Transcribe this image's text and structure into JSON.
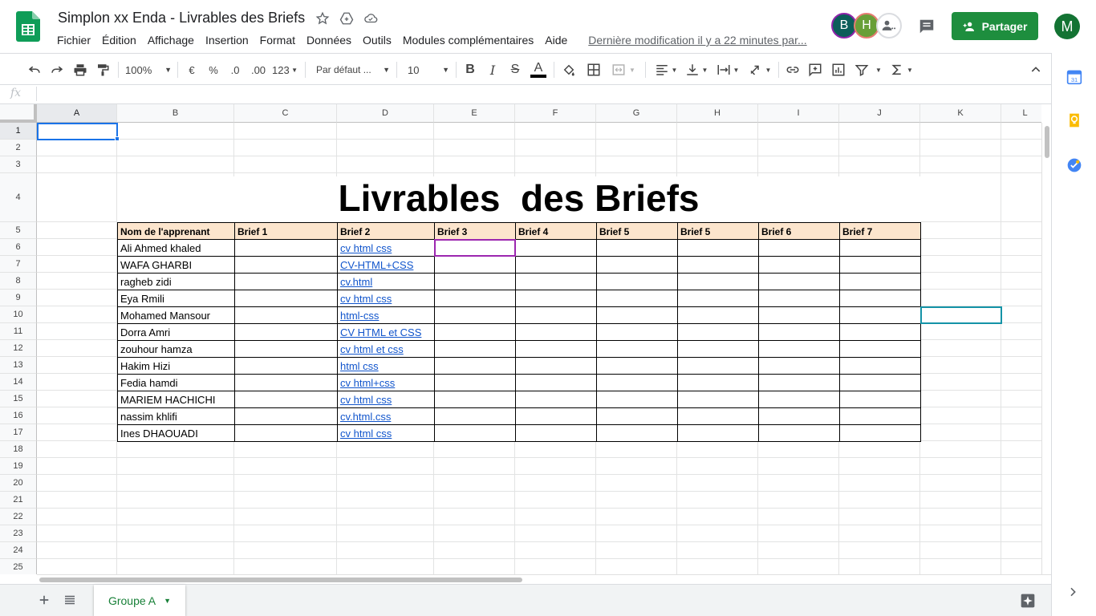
{
  "header": {
    "title": "Simplon xx Enda - Livrables des Briefs",
    "last_modified": "Dernière modification il y a 22 minutes par...",
    "share_label": "Partager",
    "avatars": [
      {
        "initial": "B",
        "color": "#0b5d5a"
      },
      {
        "initial": "H",
        "color": "#689f38"
      }
    ],
    "account_initial": "M"
  },
  "menu": [
    "Fichier",
    "Édition",
    "Affichage",
    "Insertion",
    "Format",
    "Données",
    "Outils",
    "Modules complémentaires",
    "Aide"
  ],
  "toolbar": {
    "zoom": "100%",
    "currency": "€",
    "percent": "%",
    "dec_less": ".0",
    "dec_more": ".00",
    "more_formats": "123",
    "font": "Par défaut ...",
    "font_size": "10",
    "bold": "B",
    "italic": "I",
    "strike": "S",
    "text_color": "A"
  },
  "formula_bar": {
    "fx": "fx",
    "value": ""
  },
  "columns": [
    "A",
    "B",
    "C",
    "D",
    "E",
    "F",
    "G",
    "H",
    "I",
    "J",
    "K",
    "L"
  ],
  "rows": [
    "1",
    "2",
    "3",
    "4",
    "5",
    "6",
    "7",
    "8",
    "9",
    "10",
    "11",
    "12",
    "13",
    "14",
    "15",
    "16",
    "17",
    "18",
    "19",
    "20",
    "21",
    "22",
    "23",
    "24",
    "25"
  ],
  "sheet": {
    "title": "Livrables  des Briefs",
    "headers": [
      "Nom de l'apprenant",
      "Brief 1",
      "Brief 2",
      "Brief 3",
      "Brief 4",
      "Brief 5",
      "Brief 5",
      "Brief 6",
      "Brief 7"
    ],
    "students": [
      {
        "name": "Ali Ahmed khaled",
        "brief2": "cv html css"
      },
      {
        "name": "WAFA GHARBI",
        "brief2": "CV-HTML+CSS"
      },
      {
        "name": "ragheb zidi",
        "brief2": "cv.html"
      },
      {
        "name": "Eya Rmili",
        "brief2": "cv html css"
      },
      {
        "name": "Mohamed Mansour",
        "brief2": "html-css"
      },
      {
        "name": "Dorra Amri",
        "brief2": "CV HTML et CSS"
      },
      {
        "name": "zouhour hamza",
        "brief2": "cv html et css "
      },
      {
        "name": "Hakim Hizi",
        "brief2": "html css"
      },
      {
        "name": "Fedia hamdi",
        "brief2": "cv html+css"
      },
      {
        "name": "MARIEM  HACHICHI",
        "brief2": "cv html css"
      },
      {
        "name": "nassim khlifi",
        "brief2": "cv.html.css"
      },
      {
        "name": "Ines DHAOUADI",
        "brief2": "cv html css"
      }
    ]
  },
  "tabs": {
    "active": "Groupe A"
  },
  "colors": {
    "accent": "#1a73e8",
    "share_green": "#1e8e3e",
    "header_fill": "#fce5cd",
    "link": "#1155cc"
  }
}
